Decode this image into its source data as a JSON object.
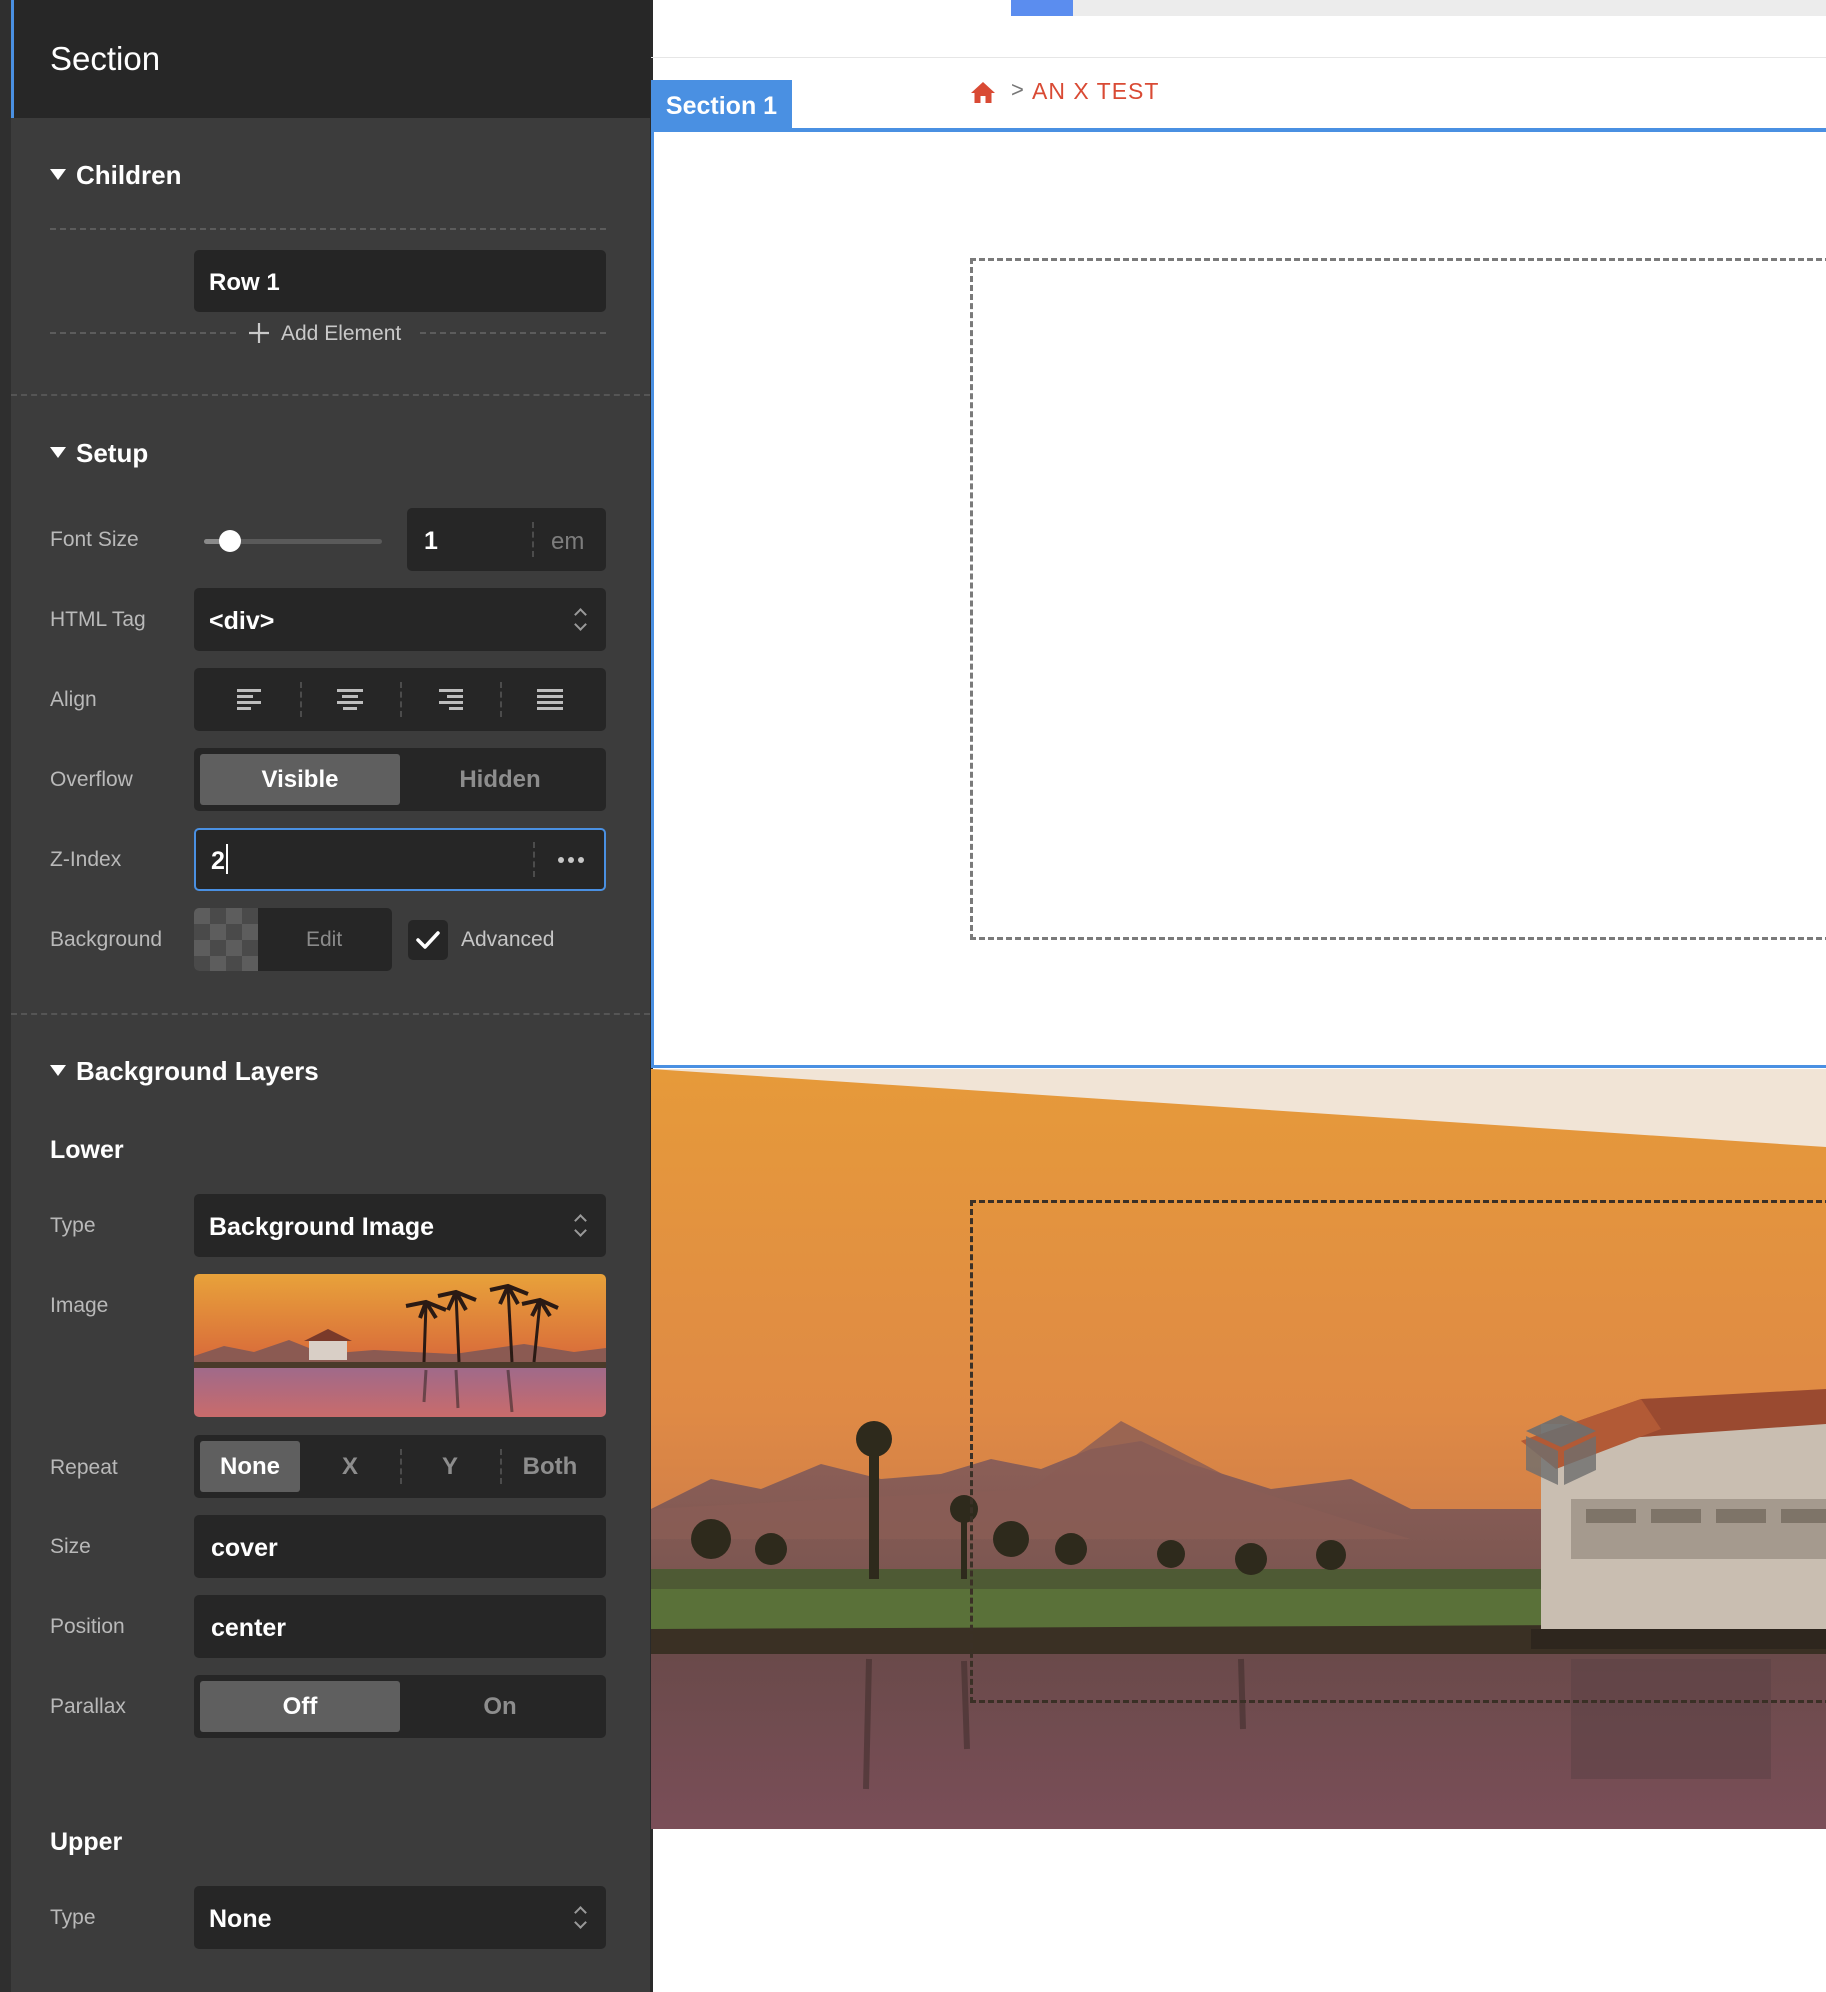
{
  "panel": {
    "title": "Section",
    "children": {
      "heading": "Children",
      "items": [
        "Row 1"
      ],
      "add_label": "Add Element"
    },
    "setup": {
      "heading": "Setup",
      "font_size": {
        "label": "Font Size",
        "value": "1",
        "unit": "em",
        "slider_fraction": 0.12
      },
      "html_tag": {
        "label": "HTML Tag",
        "value": "<div>"
      },
      "align": {
        "label": "Align",
        "options": [
          "left",
          "center",
          "right",
          "justify"
        ]
      },
      "overflow": {
        "label": "Overflow",
        "options": [
          "Visible",
          "Hidden"
        ],
        "selected": "Visible"
      },
      "z_index": {
        "label": "Z-Index",
        "value": "2"
      },
      "background": {
        "label": "Background",
        "edit_label": "Edit",
        "advanced_label": "Advanced",
        "advanced_checked": true
      }
    },
    "background_layers": {
      "heading": "Background Layers",
      "lower": {
        "heading": "Lower",
        "type": {
          "label": "Type",
          "value": "Background Image"
        },
        "image": {
          "label": "Image"
        },
        "repeat": {
          "label": "Repeat",
          "options": [
            "None",
            "X",
            "Y",
            "Both"
          ],
          "selected": "None"
        },
        "size": {
          "label": "Size",
          "value": "cover"
        },
        "position": {
          "label": "Position",
          "value": "center"
        },
        "parallax": {
          "label": "Parallax",
          "options": [
            "Off",
            "On"
          ],
          "selected": "Off"
        }
      },
      "upper": {
        "heading": "Upper",
        "type": {
          "label": "Type",
          "value": "None"
        }
      }
    }
  },
  "canvas": {
    "section_tab": "Section 1",
    "breadcrumb": {
      "separator": ">",
      "current": "AN X TEST"
    }
  },
  "colors": {
    "accent_blue": "#4a90e2",
    "breadcrumb_red": "#d94a34",
    "panel_bg": "#3c3c3c",
    "field_bg": "#262626"
  },
  "icons": {
    "breadcrumb_home": "home-icon",
    "add": "plus-icon",
    "z_index_more": "ellipsis-icon",
    "select_arrows": "chevron-up-down-icon",
    "checkbox": "check-icon",
    "builder_element": "cube-icon"
  }
}
